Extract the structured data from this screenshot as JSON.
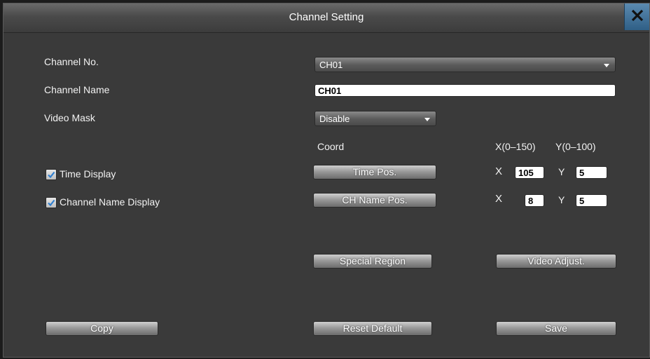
{
  "window": {
    "title": "Channel Setting",
    "close_icon": "close-icon"
  },
  "labels": {
    "channel_no": "Channel No.",
    "channel_name": "Channel Name",
    "video_mask": "Video Mask",
    "coord": "Coord",
    "x_range": "X(0–150)",
    "y_range": "Y(0–100)"
  },
  "fields": {
    "channel_no_value": "CH01",
    "channel_name_value": "CH01",
    "video_mask_value": "Disable"
  },
  "time_display": {
    "label": "Time Display",
    "checked": true,
    "button": "Time Pos.",
    "x_label": "X",
    "x_value": "105",
    "y_label": "Y",
    "y_value": "5"
  },
  "channel_name_display": {
    "label": "Channel Name Display",
    "checked": true,
    "button": "CH Name Pos.",
    "x_label": "X",
    "x_value": "8",
    "y_label": "Y",
    "y_value": "5"
  },
  "buttons": {
    "special_region": "Special Region",
    "video_adjust": "Video Adjust.",
    "copy": "Copy",
    "reset_default": "Reset Default",
    "save": "Save"
  },
  "colors": {
    "close_button": "#2f5f86",
    "check_mark": "#2f7fd0"
  }
}
